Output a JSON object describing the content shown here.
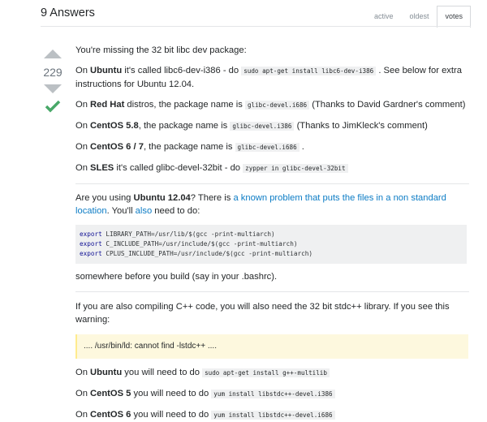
{
  "header": {
    "answers_title": "9 Answers",
    "tabs": [
      {
        "label": "active",
        "selected": false
      },
      {
        "label": "oldest",
        "selected": false
      },
      {
        "label": "votes",
        "selected": true
      }
    ]
  },
  "vote": {
    "score": "229",
    "accepted": true
  },
  "post": {
    "p1": "You're missing the 32 bit libc dev package:",
    "ubuntu": {
      "pre": "On ",
      "name": "Ubuntu",
      "mid": " it's called libc6-dev-i386 - do ",
      "code": "sudo apt-get install libc6-dev-i386",
      "post": " . See below for extra instructions for Ubuntu 12.04."
    },
    "redhat": {
      "pre": "On ",
      "name": "Red Hat",
      "mid": " distros, the package name is ",
      "code": "glibc-devel.i686",
      "post": " (Thanks to David Gardner's comment)"
    },
    "centos58": {
      "pre": "On ",
      "name": "CentOS 5.8",
      "mid": ", the package name is ",
      "code": "glibc-devel.i386",
      "post": " (Thanks to JimKleck's comment)"
    },
    "centos67": {
      "pre": "On ",
      "name": "CentOS 6 / 7",
      "mid": ", the package name is ",
      "code": "glibc-devel.i686",
      "post": " ."
    },
    "sles": {
      "pre": "On ",
      "name": "SLES",
      "mid": " it's called glibc-devel-32bit - do ",
      "code": "zypper in glibc-devel-32bit",
      "post": ""
    },
    "ubuntu1204": {
      "pre": "Are you using ",
      "name": "Ubuntu 12.04",
      "mid": "? There is ",
      "link1": "a known problem that puts the files in a non standard location",
      "mid2": ". You'll ",
      "link2": "also",
      "post": " need to do:"
    },
    "code_block": [
      {
        "kw": "export",
        "rest": " LIBRARY_PATH=/usr/lib/$(gcc -print-multiarch)"
      },
      {
        "kw": "export",
        "rest": " C_INCLUDE_PATH=/usr/include/$(gcc -print-multiarch)"
      },
      {
        "kw": "export",
        "rest": " CPLUS_INCLUDE_PATH=/usr/include/$(gcc -print-multiarch)"
      }
    ],
    "somewhere": "somewhere before you build (say in your .bashrc).",
    "cpp_intro": "If you are also compiling C++ code, you will also need the 32 bit stdc++ library. If you see this warning:",
    "warning": ".... /usr/bin/ld: cannot find -lstdc++ ....",
    "ubuntu_cpp": {
      "pre": "On ",
      "name": "Ubuntu",
      "mid": " you will need to do ",
      "code": "sudo apt-get install g++-multilib"
    },
    "centos5_cpp": {
      "pre": "On ",
      "name": "CentOS 5",
      "mid": " you will need to do ",
      "code": "yum install libstdc++-devel.i386"
    },
    "centos6_cpp": {
      "pre": "On ",
      "name": "CentOS 6",
      "mid": " you will need to do ",
      "code": "yum install libstdc++-devel.i686"
    }
  },
  "colors": {
    "accent_link": "#0c7cc5",
    "accepted_green": "#48a868",
    "warning_bg": "#fdf8de"
  }
}
